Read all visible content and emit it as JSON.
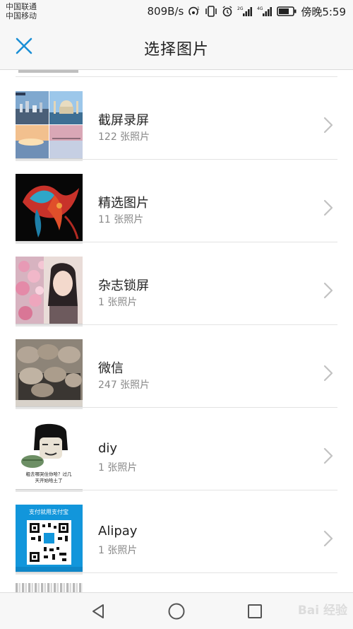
{
  "status_bar": {
    "carrier_1": "中国联通",
    "carrier_2": "中国移动",
    "speed": "809B/s",
    "time": "傍晚5:59",
    "net_1": "2G",
    "net_2": "4G"
  },
  "header": {
    "title": "选择图片"
  },
  "albums": [
    {
      "name": "截屏录屏",
      "count": "122 张照片",
      "icon": "screenshot-thumb"
    },
    {
      "name": "精选图片",
      "count": "11 张照片",
      "icon": "featured-thumb"
    },
    {
      "name": "杂志锁屏",
      "count": "1 张照片",
      "icon": "magazine-thumb"
    },
    {
      "name": "微信",
      "count": "247 张照片",
      "icon": "wechat-thumb"
    },
    {
      "name": "diy",
      "count": "1 张照片",
      "icon": "diy-thumb"
    },
    {
      "name": "Alipay",
      "count": "1 张照片",
      "icon": "alipay-thumb"
    }
  ],
  "thumb_text": {
    "diy_caption_1": "粗去哪哭住你哈？过几",
    "diy_caption_2": "天开始哈土了",
    "alipay_header": "支付就用支付宝"
  },
  "watermark": "Bai 经验",
  "colors": {
    "accent": "#1a8fd6",
    "alipay_blue": "#1296db",
    "chevron": "#c2c2c2"
  }
}
